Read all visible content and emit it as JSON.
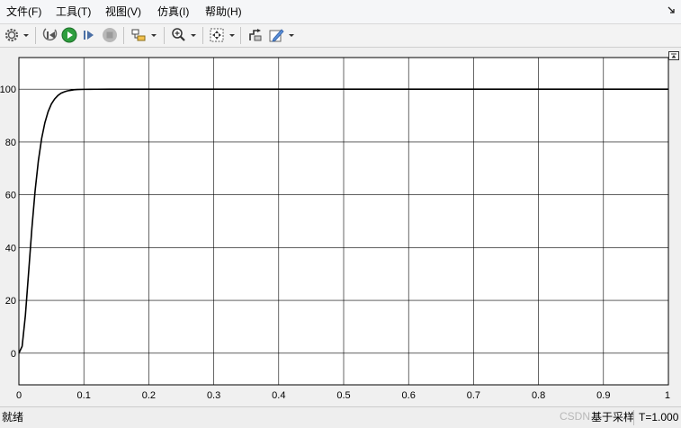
{
  "menu": {
    "items": [
      {
        "label": "文件(F)"
      },
      {
        "label": "工具(T)"
      },
      {
        "label": "视图(V)"
      },
      {
        "label": "仿真(I)"
      },
      {
        "label": "帮助(H)"
      }
    ]
  },
  "toolbar": {
    "buttons": [
      "settings-icon",
      "step-back-icon",
      "run-icon",
      "step-forward-icon",
      "stop-icon",
      "highlight-block-icon",
      "zoom-icon",
      "autoscale-icon",
      "signal-select-icon",
      "style-icon"
    ]
  },
  "colors": {
    "plot_bg": "#ffffff",
    "grid": "#000000",
    "line": "#000000",
    "run_button": "#2e9e3e",
    "ui_bg": "#f0f0f0"
  },
  "chart_data": {
    "type": "line",
    "title": "",
    "xlabel": "",
    "ylabel": "",
    "xlim": [
      0,
      1
    ],
    "ylim": [
      -12,
      112
    ],
    "grid": true,
    "x_ticks": [
      "0",
      "0.1",
      "0.2",
      "0.3",
      "0.4",
      "0.5",
      "0.6",
      "0.7",
      "0.8",
      "0.9",
      "1"
    ],
    "y_ticks": [
      "0",
      "20",
      "40",
      "60",
      "80",
      "100"
    ],
    "series": [
      {
        "color": "#000000",
        "x": [
          0,
          0.005,
          0.01,
          0.015,
          0.02,
          0.025,
          0.03,
          0.035,
          0.04,
          0.045,
          0.05,
          0.055,
          0.06,
          0.065,
          0.07,
          0.075,
          0.08,
          0.085,
          0.09,
          0.1,
          0.11,
          0.12,
          0.14,
          0.16,
          0.2,
          0.3,
          0.4,
          0.5,
          0.6,
          0.7,
          0.8,
          0.9,
          1.0
        ],
        "y": [
          0,
          2.6,
          14.3,
          30.7,
          47.3,
          61.6,
          72.9,
          81.3,
          87.3,
          91.5,
          94.4,
          96.3,
          97.6,
          98.5,
          99.0,
          99.4,
          99.6,
          99.8,
          99.9,
          99.95,
          99.98,
          99.99,
          100,
          100,
          100,
          100,
          100,
          100,
          100,
          100,
          100,
          100,
          100
        ]
      }
    ]
  },
  "status": {
    "text": "就绪",
    "sample_mode": "基于采样",
    "time": "T=1.000"
  },
  "watermark": "CSDN"
}
